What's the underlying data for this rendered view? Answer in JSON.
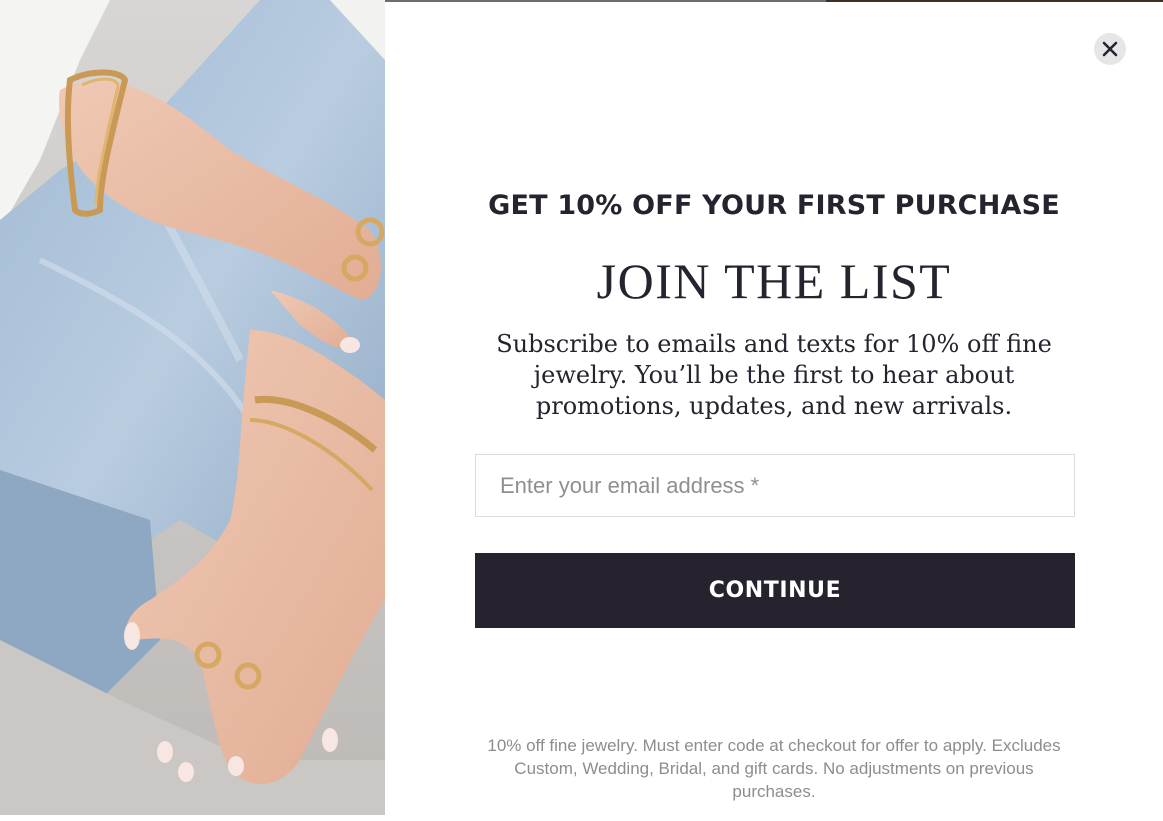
{
  "modal": {
    "eyebrow": "GET 10% OFF YOUR FIRST PURCHASE",
    "headline": "JOIN THE LIST",
    "subtext": "Subscribe to emails and texts for 10% off fine jewelry. You’ll be the first to hear about promotions, updates, and new arrivals.",
    "email_placeholder": "Enter your email address *",
    "email_value": "",
    "continue_label": "CONTINUE",
    "disclaimer": "10% off fine jewelry. Must enter code at checkout for offer to apply. Excludes Custom, Wedding, Bridal, and gift cards. No adjustments on previous purchases."
  },
  "icons": {
    "close": "close-icon"
  },
  "colors": {
    "brand_dark": "#26232f",
    "close_bg": "#e6e6e6",
    "muted_text": "#8d8d8d",
    "input_border": "#dcdcdc"
  }
}
